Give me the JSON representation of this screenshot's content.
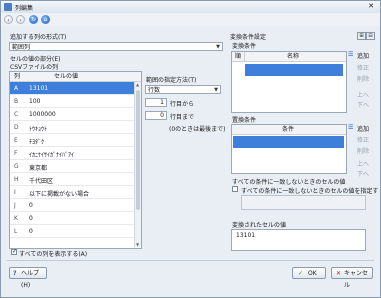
{
  "window": {
    "title": "列編集"
  },
  "toolbar": {
    "icons": [
      "back-icon",
      "forward-icon",
      "refresh-icon",
      "home-icon"
    ]
  },
  "left": {
    "format_label": "追加する列の形式(T)",
    "format_value": "範囲列",
    "cell_part_label": "セルの値の部分(E)",
    "csv_label": "CSVファイルの列",
    "col_header": "列",
    "val_header": "セルの値",
    "rows": [
      {
        "letter": "A",
        "value": "13101"
      },
      {
        "letter": "B",
        "value": "100"
      },
      {
        "letter": "C",
        "value": "1000000"
      },
      {
        "letter": "D",
        "value": "ﾄｳｷｮｳﾄ"
      },
      {
        "letter": "E",
        "value": "ﾁﾖﾀﾞｸ"
      },
      {
        "letter": "F",
        "value": "ｲｶﾆｹｲｻｲｶﾞﾅｲﾊﾞｱｲ"
      },
      {
        "letter": "G",
        "value": "東京都"
      },
      {
        "letter": "H",
        "value": "千代田区"
      },
      {
        "letter": "I",
        "value": "以下に掲載がない場合"
      },
      {
        "letter": "J",
        "value": "0"
      },
      {
        "letter": "K",
        "value": "0"
      },
      {
        "letter": "L",
        "value": "0"
      }
    ],
    "range_label": "範囲の指定方法(T)",
    "range_value": "行数",
    "from_value": "1",
    "from_label": "行目から",
    "to_value": "0",
    "to_label": "行目まで",
    "note": "(0のときは最後まで)",
    "show_all_label": "すべての列を表示する(A)"
  },
  "right": {
    "settings_label": "変換条件設定",
    "conditions_label": "変換条件",
    "cond_col_num": "順",
    "cond_col_name": "名称",
    "conv_cond_label": "置換条件",
    "conv_col": "条件",
    "side": {
      "add": "追加",
      "edit": "修正",
      "delete": "削除",
      "up": "上へ",
      "down": "下へ"
    },
    "nomatch_label": "すべての条件に一致しないときのセルの値",
    "nomatch_check": "すべての条件に一致しないときのセルの値を指定する",
    "converted_label": "変換されたセルの値",
    "converted_value": "13101"
  },
  "footer": {
    "help": "ヘルプ(H)",
    "ok": "OK",
    "cancel": "キャンセル"
  },
  "colors": {
    "selection": "#3e7fdb",
    "window_bg": "#e9eef4"
  }
}
